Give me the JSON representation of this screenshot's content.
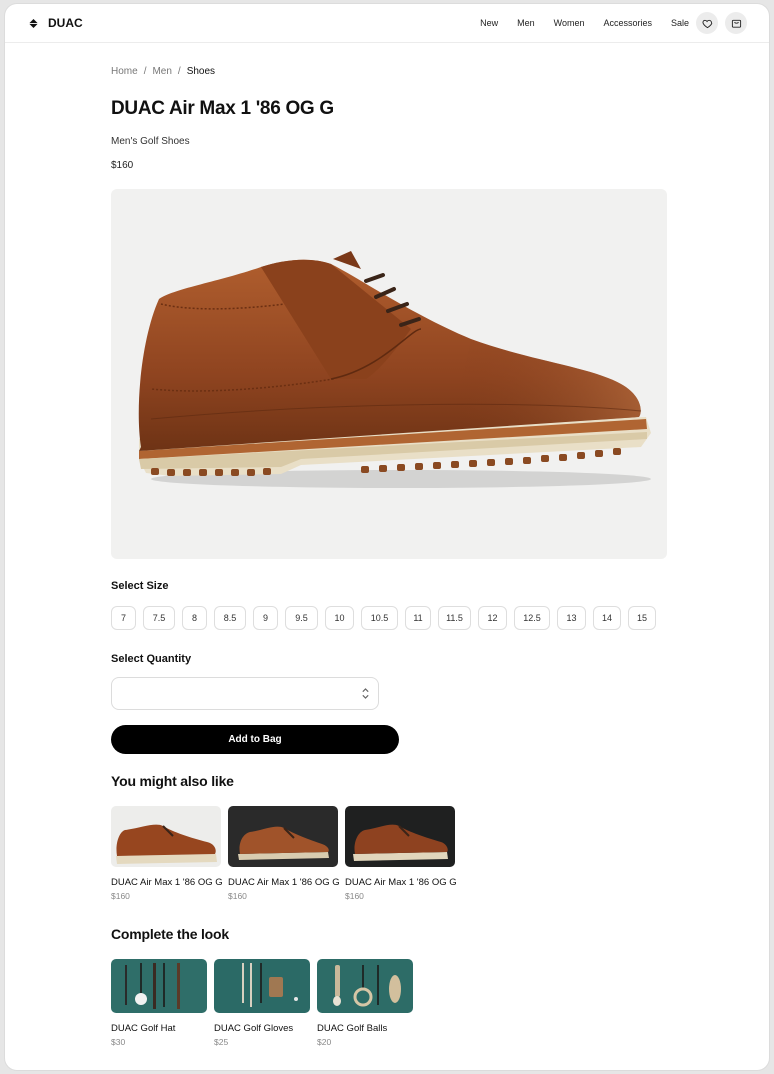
{
  "brand": {
    "name": "DUAC"
  },
  "nav": {
    "links": [
      "New",
      "Men",
      "Women",
      "Accessories",
      "Sale"
    ],
    "icons": [
      "heart-icon",
      "bag-icon"
    ]
  },
  "breadcrumb": {
    "items": [
      "Home",
      "Men",
      "Shoes"
    ],
    "separator": "/"
  },
  "product": {
    "title": "DUAC Air Max 1 '86 OG G",
    "subtitle": "Men's Golf Shoes",
    "price": "$160",
    "image": "brown leather golf shoe"
  },
  "size": {
    "label": "Select Size",
    "options": [
      "7",
      "7.5",
      "8",
      "8.5",
      "9",
      "9.5",
      "10",
      "10.5",
      "11",
      "11.5",
      "12",
      "12.5",
      "13",
      "14",
      "15"
    ]
  },
  "quantity": {
    "label": "Select Quantity",
    "value": ""
  },
  "cta": {
    "add_to_bag": "Add to Bag"
  },
  "recommendations": {
    "heading": "You might also like",
    "items": [
      {
        "name": "DUAC Air Max 1 '86 OG G",
        "price": "$160"
      },
      {
        "name": "DUAC Air Max 1 '86 OG G",
        "price": "$160"
      },
      {
        "name": "DUAC Air Max 1 '86 OG G",
        "price": "$160"
      }
    ]
  },
  "complete_look": {
    "heading": "Complete the look",
    "items": [
      {
        "name": "DUAC Golf Hat",
        "price": "$30"
      },
      {
        "name": "DUAC Golf Gloves",
        "price": "$25"
      },
      {
        "name": "DUAC Golf Balls",
        "price": "$20"
      }
    ]
  },
  "colors": {
    "accent": "#000000",
    "leather": "#9a4a22",
    "teal": "#2f6e69"
  }
}
